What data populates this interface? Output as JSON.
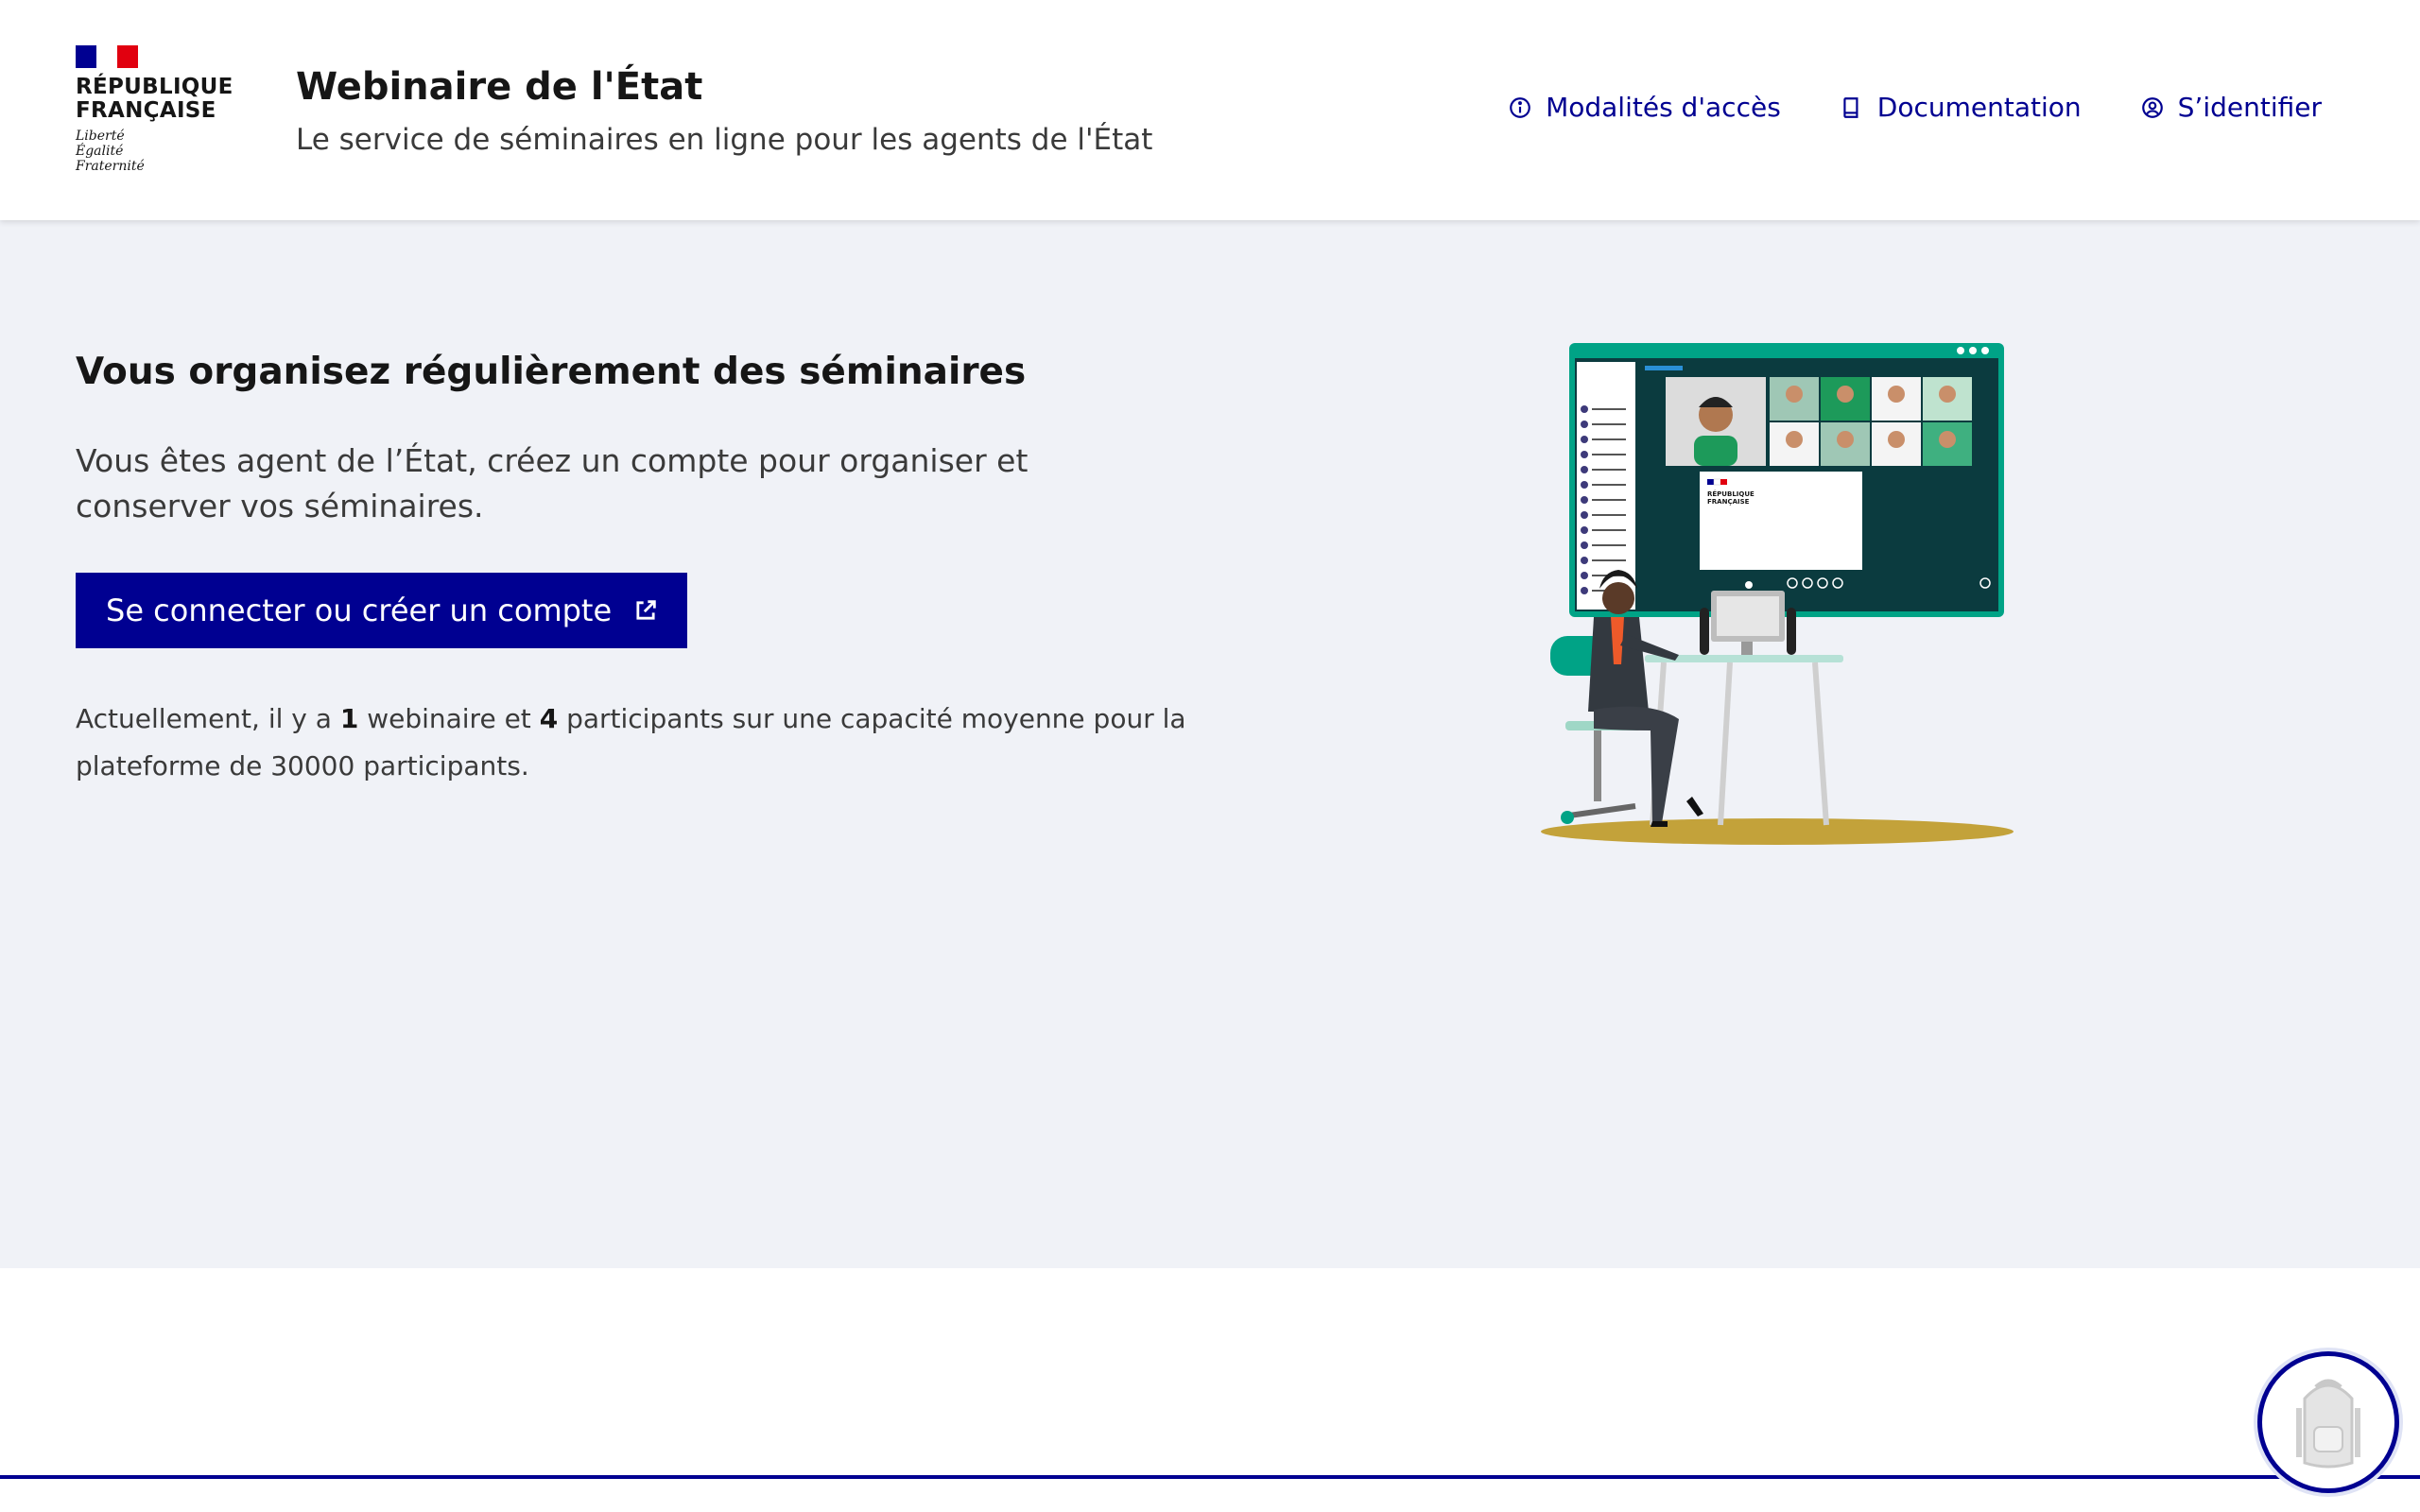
{
  "logo": {
    "line1": "RÉPUBLIQUE",
    "line2": "FRANÇAISE",
    "motto": [
      "Liberté",
      "Égalité",
      "Fraternité"
    ]
  },
  "service": {
    "title": "Webinaire de l'État",
    "tagline": "Le service de séminaires en ligne pour les agents de l'État"
  },
  "nav": [
    {
      "label": "Modalités d'accès",
      "icon": "info-icon"
    },
    {
      "label": "Documentation",
      "icon": "book-icon"
    },
    {
      "label": "S’identifier",
      "icon": "user-icon"
    }
  ],
  "hero": {
    "title": "Vous organisez régulièrement des séminaires",
    "text": "Vous êtes agent de l’État, créez un compte pour organiser et conserver vos séminaires.",
    "cta": "Se connecter ou créer un compte",
    "stats": {
      "prefix": "Actuellement, il y a ",
      "webinars": "1",
      "mid1": " webinaire et ",
      "participants": "4",
      "suffix": " participants sur une capacité moyenne pour la plateforme de 30000 participants."
    }
  },
  "illustration_screen_text": [
    "RÉPUBLIQUE",
    "FRANÇAISE"
  ],
  "colors": {
    "primary": "#000091",
    "background": "#f0f2f7",
    "accent_teal": "#00a386",
    "floor": "#c3a23a"
  }
}
